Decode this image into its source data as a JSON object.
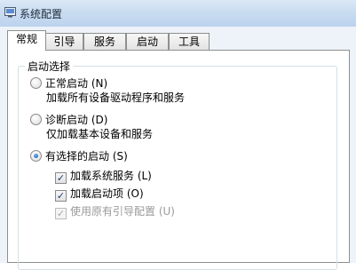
{
  "window": {
    "title": "系统配置"
  },
  "tabs": [
    {
      "label": "常规",
      "selected": true
    },
    {
      "label": "引导",
      "selected": false
    },
    {
      "label": "服务",
      "selected": false
    },
    {
      "label": "启动",
      "selected": false
    },
    {
      "label": "工具",
      "selected": false
    }
  ],
  "startup_selection": {
    "legend": "启动选择",
    "options": [
      {
        "label": "正常启动 (N)",
        "description": "加载所有设备驱动程序和服务",
        "checked": false
      },
      {
        "label": "诊断启动 (D)",
        "description": "仅加载基本设备和服务",
        "checked": false
      },
      {
        "label": "有选择的启动 (S)",
        "description": "",
        "checked": true
      }
    ],
    "selective_items": [
      {
        "label": "加载系统服务 (L)",
        "checked": true,
        "disabled": false
      },
      {
        "label": "加载启动项 (O)",
        "checked": true,
        "disabled": false
      },
      {
        "label": "使用原有引导配置 (U)",
        "checked": true,
        "disabled": true
      }
    ]
  },
  "icons": {
    "app": "msconfig-icon"
  }
}
